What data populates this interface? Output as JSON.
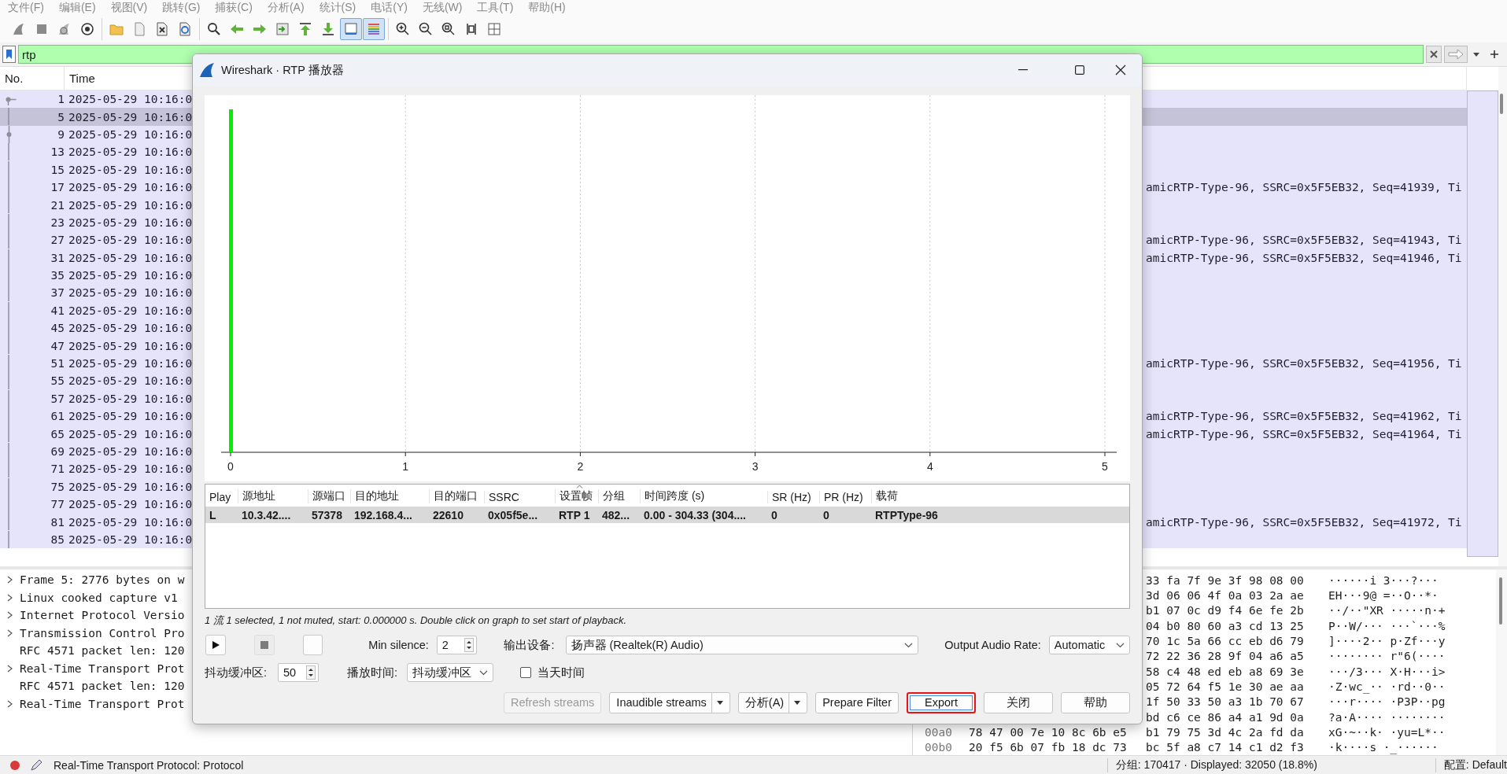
{
  "menu": [
    "文件(F)",
    "编辑(E)",
    "视图(V)",
    "跳转(G)",
    "捕获(C)",
    "分析(A)",
    "统计(S)",
    "电话(Y)",
    "无线(W)",
    "工具(T)",
    "帮助(H)"
  ],
  "toolbar": [
    [
      {
        "kind": "fin",
        "pressed": false
      },
      {
        "kind": "stop",
        "pressed": false
      },
      {
        "kind": "restart",
        "pressed": false
      },
      {
        "kind": "options",
        "pressed": false
      }
    ],
    [
      {
        "kind": "folder",
        "pressed": false
      },
      {
        "kind": "file",
        "pressed": false
      },
      {
        "kind": "close-file",
        "pressed": false
      },
      {
        "kind": "reload",
        "pressed": false
      }
    ],
    [
      {
        "kind": "find",
        "pressed": false
      },
      {
        "kind": "back",
        "pressed": false
      },
      {
        "kind": "forward",
        "pressed": false
      },
      {
        "kind": "goto",
        "pressed": false
      },
      {
        "kind": "first",
        "pressed": false
      },
      {
        "kind": "last",
        "pressed": false
      },
      {
        "kind": "autoscroll",
        "pressed": true
      },
      {
        "kind": "colorize",
        "pressed": true
      }
    ],
    [
      {
        "kind": "zoom-in",
        "pressed": false
      },
      {
        "kind": "zoom-out",
        "pressed": false
      },
      {
        "kind": "zoom-reset",
        "pressed": false
      },
      {
        "kind": "resize",
        "pressed": false
      },
      {
        "kind": "layout",
        "pressed": false
      }
    ]
  ],
  "filter": {
    "value": "rtp"
  },
  "packet_list": {
    "columns": [
      "No.",
      "Time"
    ],
    "rows": [
      {
        "no": "1",
        "time": "2025-05-29 10:16:0",
        "selected": false,
        "kind": "start"
      },
      {
        "no": "5",
        "time": "2025-05-29 10:16:0",
        "selected": true,
        "kind": "line"
      },
      {
        "no": "9",
        "time": "2025-05-29 10:16:0",
        "selected": false,
        "kind": "dot"
      },
      {
        "no": "13",
        "time": "2025-05-29 10:16:0",
        "selected": false,
        "kind": "line"
      },
      {
        "no": "15",
        "time": "2025-05-29 10:16:0",
        "selected": false,
        "kind": "line"
      },
      {
        "no": "17",
        "time": "2025-05-29 10:16:0",
        "selected": false,
        "kind": "line",
        "info": "amicRTP-Type-96, SSRC=0x5F5EB32, Seq=41939, Ti"
      },
      {
        "no": "21",
        "time": "2025-05-29 10:16:0",
        "selected": false,
        "kind": "line"
      },
      {
        "no": "23",
        "time": "2025-05-29 10:16:0",
        "selected": false,
        "kind": "line"
      },
      {
        "no": "27",
        "time": "2025-05-29 10:16:0",
        "selected": false,
        "kind": "line",
        "info": "amicRTP-Type-96, SSRC=0x5F5EB32, Seq=41943, Ti"
      },
      {
        "no": "31",
        "time": "2025-05-29 10:16:0",
        "selected": false,
        "kind": "line",
        "info": "amicRTP-Type-96, SSRC=0x5F5EB32, Seq=41946, Ti"
      },
      {
        "no": "35",
        "time": "2025-05-29 10:16:0",
        "selected": false,
        "kind": "line"
      },
      {
        "no": "37",
        "time": "2025-05-29 10:16:0",
        "selected": false,
        "kind": "line"
      },
      {
        "no": "41",
        "time": "2025-05-29 10:16:0",
        "selected": false,
        "kind": "line"
      },
      {
        "no": "45",
        "time": "2025-05-29 10:16:0",
        "selected": false,
        "kind": "line"
      },
      {
        "no": "47",
        "time": "2025-05-29 10:16:0",
        "selected": false,
        "kind": "line"
      },
      {
        "no": "51",
        "time": "2025-05-29 10:16:0",
        "selected": false,
        "kind": "line",
        "info": "amicRTP-Type-96, SSRC=0x5F5EB32, Seq=41956, Ti"
      },
      {
        "no": "55",
        "time": "2025-05-29 10:16:0",
        "selected": false,
        "kind": "line"
      },
      {
        "no": "57",
        "time": "2025-05-29 10:16:0",
        "selected": false,
        "kind": "line"
      },
      {
        "no": "61",
        "time": "2025-05-29 10:16:0",
        "selected": false,
        "kind": "line",
        "info": "amicRTP-Type-96, SSRC=0x5F5EB32, Seq=41962, Ti"
      },
      {
        "no": "65",
        "time": "2025-05-29 10:16:0",
        "selected": false,
        "kind": "line",
        "info": "amicRTP-Type-96, SSRC=0x5F5EB32, Seq=41964, Ti"
      },
      {
        "no": "69",
        "time": "2025-05-29 10:16:0",
        "selected": false,
        "kind": "line"
      },
      {
        "no": "71",
        "time": "2025-05-29 10:16:0",
        "selected": false,
        "kind": "line"
      },
      {
        "no": "75",
        "time": "2025-05-29 10:16:0",
        "selected": false,
        "kind": "line"
      },
      {
        "no": "77",
        "time": "2025-05-29 10:16:0",
        "selected": false,
        "kind": "line"
      },
      {
        "no": "81",
        "time": "2025-05-29 10:16:0",
        "selected": false,
        "kind": "line",
        "info": "amicRTP-Type-96, SSRC=0x5F5EB32, Seq=41972, Ti"
      },
      {
        "no": "85",
        "time": "2025-05-29 10:16:0",
        "selected": false,
        "kind": "line"
      }
    ]
  },
  "details": [
    {
      "text": "Frame 5: 2776 bytes on w",
      "expandable": true
    },
    {
      "text": "Linux cooked capture v1",
      "expandable": true
    },
    {
      "text": "Internet Protocol Versio",
      "expandable": true
    },
    {
      "text": "Transmission Control Pro",
      "expandable": true
    },
    {
      "text": "RFC 4571 packet len: 120",
      "expandable": false
    },
    {
      "text": "Real-Time Transport Prot",
      "expandable": true
    },
    {
      "text": "RFC 4571 packet len: 120",
      "expandable": false
    },
    {
      "text": "Real-Time Transport Prot",
      "expandable": true
    }
  ],
  "hex": [
    {
      "bytes": "33 fa 7f 9e 3f 98 08 00",
      "ascii": "······i 3···?···"
    },
    {
      "bytes": "3d 06 06 4f 0a 03 2a ae",
      "ascii": "EH···9@ =··O··*·"
    },
    {
      "bytes": "b1 07 0c d9 f4 6e fe 2b",
      "ascii": "··/··\"XR ·····n·+"
    },
    {
      "bytes": "04 b0 80 60 a3 cd 13 25",
      "ascii": "P··W/··· ···`···%"
    },
    {
      "bytes": "70 1c 5a 66 cc eb d6 79",
      "ascii": "]····2·· p·Zf···y"
    },
    {
      "bytes": "72 22 36 28 9f 04 a6 a5",
      "ascii": "········ r\"6(····"
    },
    {
      "bytes": "58 c4 48 ed eb a8 69 3e",
      "ascii": "···/3··· X·H···i>"
    },
    {
      "bytes": "05 72 64 f5 1e 30 ae aa",
      "ascii": "·Z·wc_·· ·rd··0··"
    },
    {
      "bytes": "1f 50 33 50 a3 1b 70 67",
      "ascii": "···r···· ·P3P··pg"
    },
    {
      "bytes": "bd c6 ce 86 a4 a1 9d 0a",
      "ascii": "?a·A···· ········"
    },
    {
      "offset": "00a0",
      "bytes_left": "78 47 00 7e 10 8c 6b e5",
      "bytes": "b1 79 75 3d 4c 2a fd da",
      "ascii": "xG·~··k· ·yu=L*··"
    },
    {
      "offset": "00b0",
      "bytes_left": "20 f5 6b 07 fb 18 dc 73",
      "bytes": "bc 5f a8 c7 14 c1 d2 f3",
      "ascii": "·k····s ·_······"
    }
  ],
  "dialog": {
    "title": "Wireshark · RTP 播放器",
    "axis_ticks": [
      "0",
      "1",
      "2",
      "3",
      "4",
      "5"
    ],
    "streams": {
      "columns": [
        {
          "label": "Play",
          "sorted": false
        },
        {
          "label": "源地址",
          "sorted": false
        },
        {
          "label": "源端口",
          "sorted": false
        },
        {
          "label": "目的地址",
          "sorted": false
        },
        {
          "label": "目的端口",
          "sorted": false
        },
        {
          "label": "SSRC",
          "sorted": false
        },
        {
          "label": "设置帧",
          "sorted": true
        },
        {
          "label": "分组",
          "sorted": false
        },
        {
          "label": "时间跨度 (s)",
          "sorted": false
        },
        {
          "label": "SR (Hz)",
          "sorted": false
        },
        {
          "label": "PR (Hz)",
          "sorted": false
        },
        {
          "label": "载荷",
          "sorted": false
        }
      ],
      "rows": [
        {
          "selected": true,
          "cells": [
            "L",
            "10.3.42....",
            "57378",
            "192.168.4...",
            "22610",
            "0x05f5e...",
            "RTP 1",
            "482...",
            "0.00 - 304.33 (304....",
            "0",
            "0",
            "RTPType-96"
          ]
        }
      ]
    },
    "status": "1 流 1 selected, 1 not muted, start: 0.000000 s. Double click on graph to set start of playback.",
    "transport": [
      {
        "kind": "play",
        "disabled": false
      },
      {
        "kind": "stop",
        "disabled": true
      },
      {
        "kind": "blank",
        "disabled": false
      }
    ],
    "min_silence": {
      "label": "Min silence:",
      "value": "2"
    },
    "output_device": {
      "label": "输出设备:",
      "value": "扬声器 (Realtek(R) Audio)"
    },
    "output_rate": {
      "label": "Output Audio Rate:",
      "value": "Automatic"
    },
    "jitter": {
      "label": "抖动缓冲区:",
      "value": "50"
    },
    "timing": {
      "label": "播放时间:",
      "value": "抖动缓冲区"
    },
    "absolute_time": {
      "label": "当天时间",
      "checked": false
    },
    "buttons": [
      {
        "label": "Refresh streams",
        "disabled": true,
        "menu": false,
        "highlighted": false
      },
      {
        "label": "Inaudible streams",
        "disabled": false,
        "menu": true,
        "highlighted": false
      },
      {
        "label": "分析(A)",
        "disabled": false,
        "menu": true,
        "highlighted": false
      },
      {
        "label": "Prepare Filter",
        "disabled": false,
        "menu": false,
        "highlighted": false
      },
      {
        "label": "Export",
        "disabled": false,
        "menu": false,
        "highlighted": true
      },
      {
        "label": "关闭",
        "disabled": false,
        "menu": false,
        "highlighted": false
      },
      {
        "label": "帮助",
        "disabled": false,
        "menu": false,
        "highlighted": false
      }
    ]
  },
  "status_bar": {
    "text": "Real-Time Transport Protocol: Protocol",
    "packets": "分组: 170417 · Displayed: 32050 (18.8%)",
    "profile": "配置: Default"
  }
}
